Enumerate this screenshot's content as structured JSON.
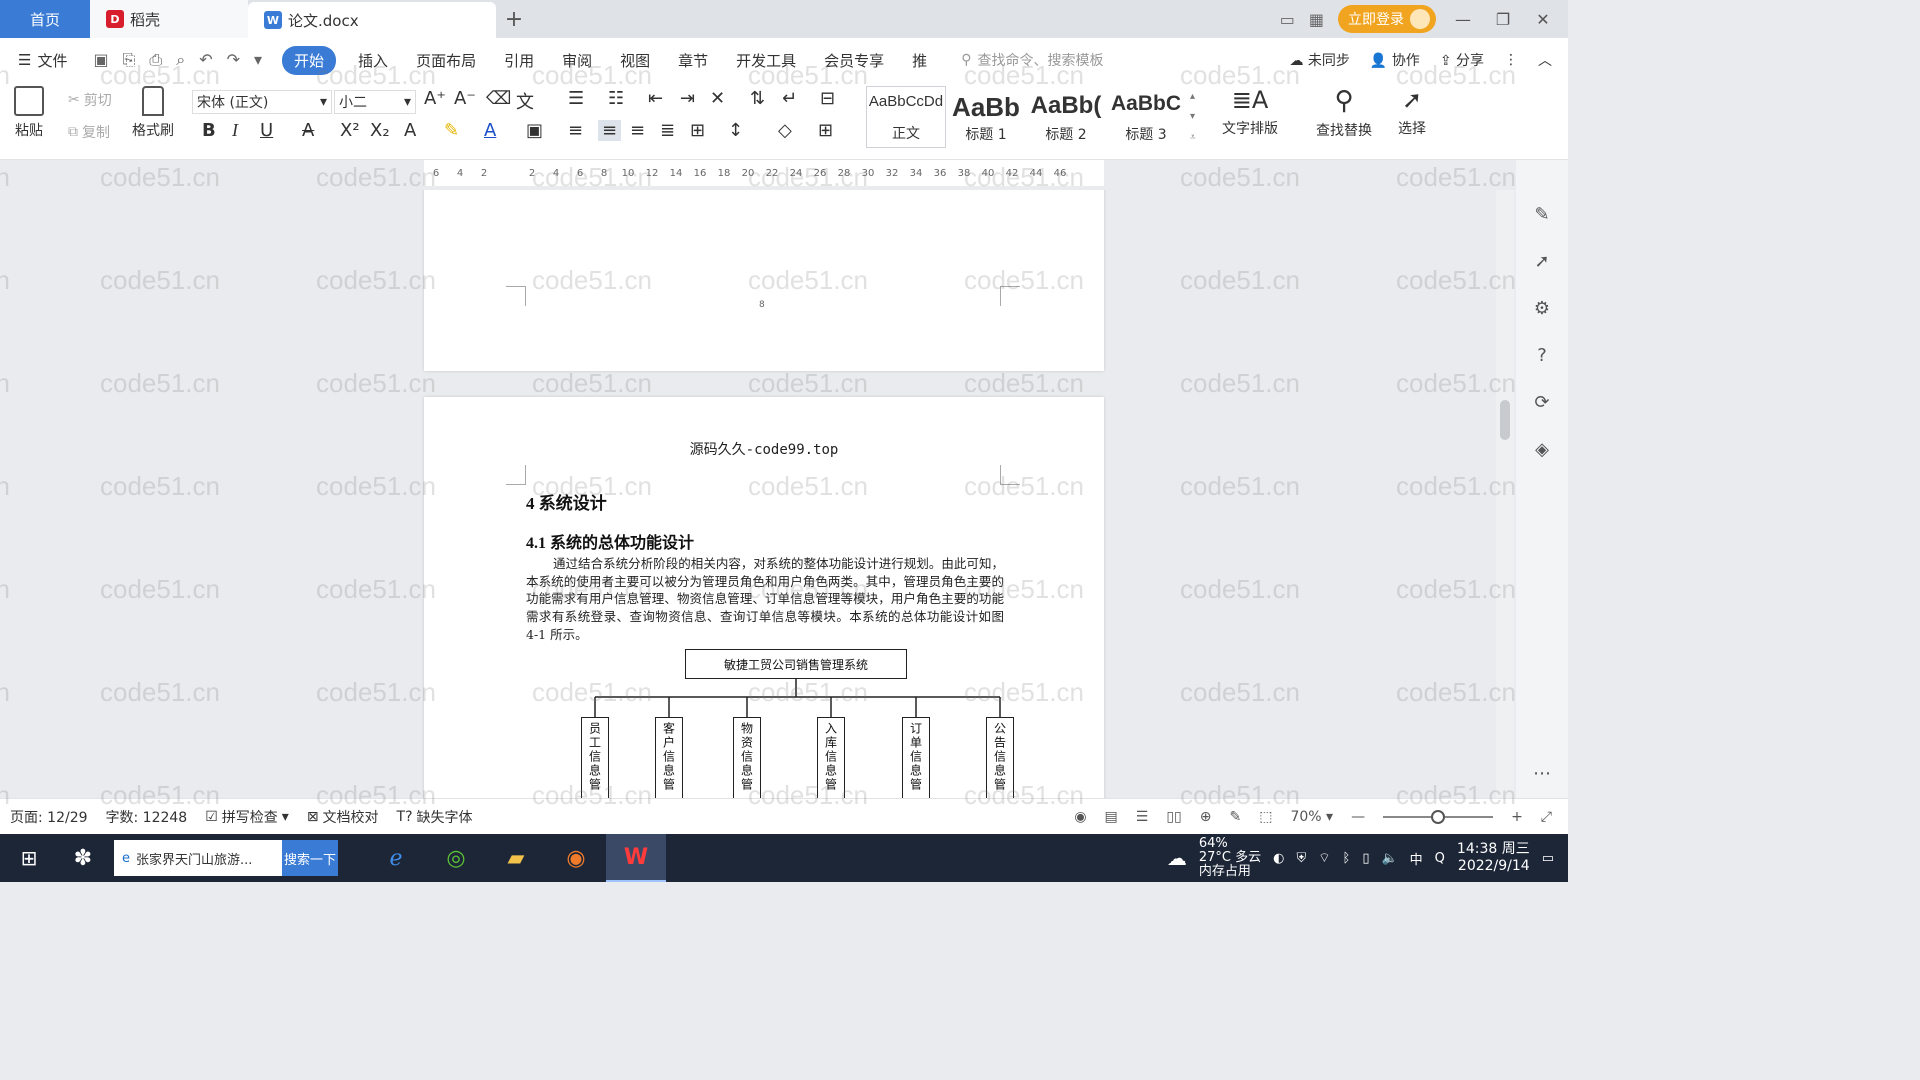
{
  "tabs": {
    "home": "首页",
    "daoke": "稻壳",
    "file": "论文.docx",
    "add": "+"
  },
  "titlebar": {
    "login": "立即登录"
  },
  "menu": {
    "file": "文件",
    "items": [
      "开始",
      "插入",
      "页面布局",
      "引用",
      "审阅",
      "视图",
      "章节",
      "开发工具",
      "会员专享",
      "推"
    ],
    "search_cmd": "查找命令、搜索模板",
    "unsynced": "未同步",
    "collab": "协作",
    "share": "分享"
  },
  "ribbon": {
    "paste": "粘贴",
    "cut": "剪切",
    "copy": "复制",
    "format_painter": "格式刷",
    "font_name": "宋体 (正文)",
    "font_size": "小二",
    "styles": [
      {
        "sample": "AaBbCcDd",
        "label": "正文"
      },
      {
        "sample": "AaBb",
        "label": "标题 1"
      },
      {
        "sample": "AaBb(",
        "label": "标题 2"
      },
      {
        "sample": "AaBbC",
        "label": "标题 3"
      }
    ],
    "text_layout": "文字排版",
    "find_replace": "查找替换",
    "select": "选择"
  },
  "ruler": {
    "ticks": [
      "6",
      "4",
      "2",
      "",
      "2",
      "4",
      "6",
      "8",
      "10",
      "12",
      "14",
      "16",
      "18",
      "20",
      "22",
      "24",
      "26",
      "28",
      "30",
      "32",
      "34",
      "36",
      "38",
      "40",
      "42",
      "44",
      "46"
    ]
  },
  "document": {
    "prev_page_number": "8",
    "header": "源码久久-code99.top",
    "heading1": "4 系统设计",
    "heading2": "4.1 系统的总体功能设计",
    "paragraph": "通过结合系统分析阶段的相关内容，对系统的整体功能设计进行规划。由此可知，本系统的使用者主要可以被分为管理员角色和用户角色两类。其中，管理员角色主要的功能需求有用户信息管理、物资信息管理、订单信息管理等模块，用户角色主要的功能需求有系统登录、查询物资信息、查询订单信息等模块。本系统的总体功能设计如图 4-1 所示。",
    "diagram_root": "敏捷工贸公司销售管理系统",
    "diagram_children": [
      "员工信息管",
      "客户信息管",
      "物资信息管",
      "入库信息管",
      "订单信息管",
      "公告信息管"
    ]
  },
  "watermark": "code51.cn",
  "status": {
    "page": "页面: 12/29",
    "words": "字数: 12248",
    "spell": "拼写检查",
    "proof": "文档校对",
    "missing_font": "缺失字体",
    "zoom": "70%"
  },
  "taskbar": {
    "search_text": "张家界天门山旅游...",
    "search_button": "搜索一下",
    "weather_pct": "64%",
    "weather": "27°C 多云",
    "memory": "内存占用",
    "ime": "中",
    "time": "14:38 周三",
    "date": "2022/9/14"
  }
}
